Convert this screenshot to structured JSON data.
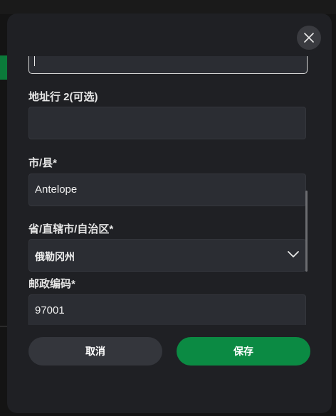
{
  "form": {
    "address_line2_label": "地址行 2(可选)",
    "address_line2_value": "",
    "city_label": "市/县*",
    "city_value": "Antelope",
    "state_label": "省/直辖市/自治区*",
    "state_value": "俄勒冈州",
    "zip_label": "邮政编码*",
    "zip_value": "97001"
  },
  "buttons": {
    "cancel_label": "取消",
    "save_label": "保存"
  },
  "icons": {
    "close": "close-icon",
    "dropdown": "chevron-down-icon"
  },
  "colors": {
    "save_button": "#0b8a43",
    "modal_bg": "#1f2024",
    "input_bg": "#2b2d33"
  }
}
